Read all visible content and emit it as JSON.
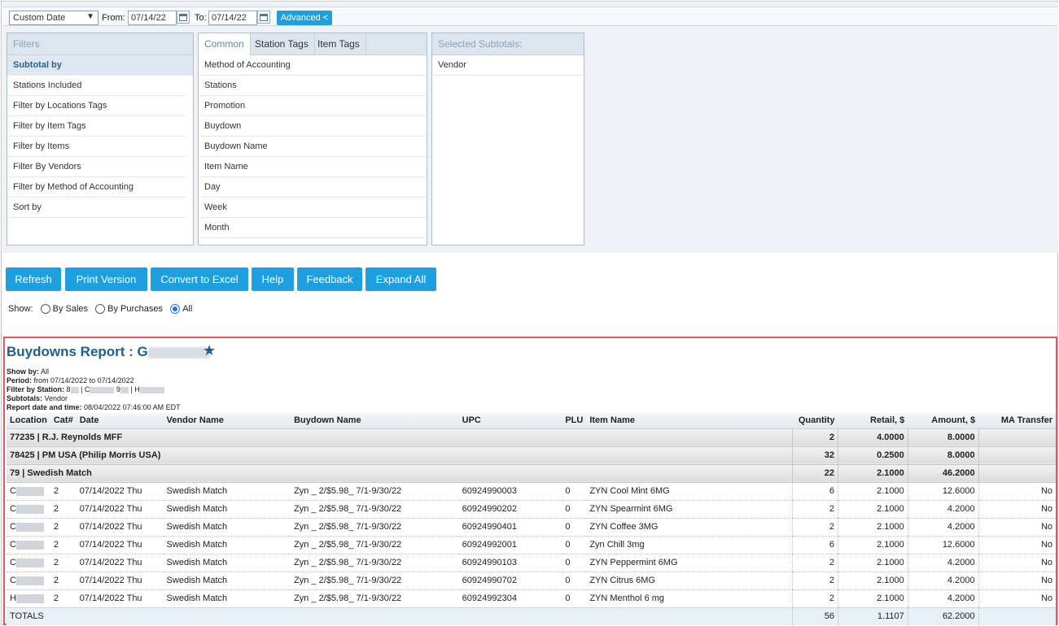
{
  "toolbar": {
    "date_range_select": "Custom Date",
    "from_label": "From:",
    "from_value": "07/14/22",
    "to_label": "To:",
    "to_value": "07/14/22",
    "advanced_label": "Advanced <"
  },
  "filters_panel": {
    "title": "Filters",
    "items": [
      "Subtotal by",
      "Stations Included",
      "Filter by Locations Tags",
      "Filter by Item Tags",
      "Filter by Items",
      "Filter By Vendors",
      "Filter by Method of Accounting",
      "Sort by"
    ]
  },
  "options_panel": {
    "tabs": [
      "Common",
      "Station Tags",
      "Item Tags"
    ],
    "items": [
      "Method of Accounting",
      "Stations",
      "Promotion",
      "Buydown",
      "Buydown Name",
      "Item Name",
      "Day",
      "Week",
      "Month"
    ]
  },
  "subtotals_panel": {
    "title": "Selected Subtotals:",
    "items": [
      "Vendor"
    ]
  },
  "actions": {
    "refresh": "Refresh",
    "print": "Print Version",
    "excel": "Convert to Excel",
    "help": "Help",
    "feedback": "Feedback",
    "expand": "Expand All"
  },
  "show": {
    "label": "Show:",
    "options": [
      "By Sales",
      "By Purchases",
      "All"
    ],
    "selected": "All"
  },
  "report": {
    "title": "Buydowns Report : G",
    "meta": {
      "show_by_label": "Show by:",
      "show_by": "All",
      "period_label": "Period:",
      "period": "from 07/14/2022 to 07/14/2022",
      "station_label": "Filter by Station:",
      "station_parts": [
        "8",
        "| C",
        "9",
        "| H"
      ],
      "subtotals_label": "Subtotals:",
      "subtotals": "Vendor",
      "date_label": "Report date and time:",
      "date": "08/04/2022 07:46:00 AM EDT"
    },
    "columns": [
      "Location",
      "Cat#",
      "Date",
      "Vendor Name",
      "Buydown Name",
      "UPC",
      "PLU",
      "Item Name",
      "Quantity",
      "Retail, $",
      "Amount, $",
      "MA Transfer"
    ],
    "subtotals": [
      {
        "label": "77235 | R.J. Reynolds MFF",
        "quantity": "2",
        "retail": "4.0000",
        "amount": "8.0000"
      },
      {
        "label": "78425 | PM USA (Philip Morris USA)",
        "quantity": "32",
        "retail": "0.2500",
        "amount": "8.0000"
      },
      {
        "label": "79 | Swedish Match",
        "quantity": "22",
        "retail": "2.1000",
        "amount": "46.2000"
      }
    ],
    "rows": [
      {
        "loc": "C",
        "cat": "2",
        "date": "07/14/2022 Thu",
        "vendor": "Swedish Match",
        "buydown": "Zyn _ 2/$5.98_ 7/1-9/30/22",
        "upc": "60924990003",
        "plu": "0",
        "item": "ZYN Cool Mint 6MG",
        "qty": "6",
        "retail": "2.1000",
        "amount": "12.6000",
        "ma": "No"
      },
      {
        "loc": "C",
        "cat": "2",
        "date": "07/14/2022 Thu",
        "vendor": "Swedish Match",
        "buydown": "Zyn _ 2/$5.98_ 7/1-9/30/22",
        "upc": "60924990202",
        "plu": "0",
        "item": "ZYN Spearmint 6MG",
        "qty": "2",
        "retail": "2.1000",
        "amount": "4.2000",
        "ma": "No"
      },
      {
        "loc": "C",
        "cat": "2",
        "date": "07/14/2022 Thu",
        "vendor": "Swedish Match",
        "buydown": "Zyn _ 2/$5.98_ 7/1-9/30/22",
        "upc": "60924990401",
        "plu": "0",
        "item": "ZYN Coffee 3MG",
        "qty": "2",
        "retail": "2.1000",
        "amount": "4.2000",
        "ma": "No"
      },
      {
        "loc": "C",
        "cat": "2",
        "date": "07/14/2022 Thu",
        "vendor": "Swedish Match",
        "buydown": "Zyn _ 2/$5.98_ 7/1-9/30/22",
        "upc": "60924992001",
        "plu": "0",
        "item": "Zyn Chill 3mg",
        "qty": "6",
        "retail": "2.1000",
        "amount": "12.6000",
        "ma": "No"
      },
      {
        "loc": "C",
        "cat": "2",
        "date": "07/14/2022 Thu",
        "vendor": "Swedish Match",
        "buydown": "Zyn _ 2/$5.98_ 7/1-9/30/22",
        "upc": "60924990103",
        "plu": "0",
        "item": "ZYN Peppermint 6MG",
        "qty": "2",
        "retail": "2.1000",
        "amount": "4.2000",
        "ma": "No"
      },
      {
        "loc": "C",
        "cat": "2",
        "date": "07/14/2022 Thu",
        "vendor": "Swedish Match",
        "buydown": "Zyn _ 2/$5.98_ 7/1-9/30/22",
        "upc": "60924990702",
        "plu": "0",
        "item": "ZYN Citrus 6MG",
        "qty": "2",
        "retail": "2.1000",
        "amount": "4.2000",
        "ma": "No"
      },
      {
        "loc": "H",
        "cat": "2",
        "date": "07/14/2022 Thu",
        "vendor": "Swedish Match",
        "buydown": "Zyn _ 2/$5.98_ 7/1-9/30/22",
        "upc": "60924992304",
        "plu": "0",
        "item": "ZYN Menthol 6 mg",
        "qty": "2",
        "retail": "2.1000",
        "amount": "4.2000",
        "ma": "No"
      }
    ],
    "totals": {
      "label": "TOTALS",
      "quantity": "56",
      "retail": "1.1107",
      "amount": "62.2000"
    }
  },
  "colors": {
    "accent": "#1ea0e0",
    "title": "#1c5e97",
    "highlight_border": "#e2555d"
  }
}
